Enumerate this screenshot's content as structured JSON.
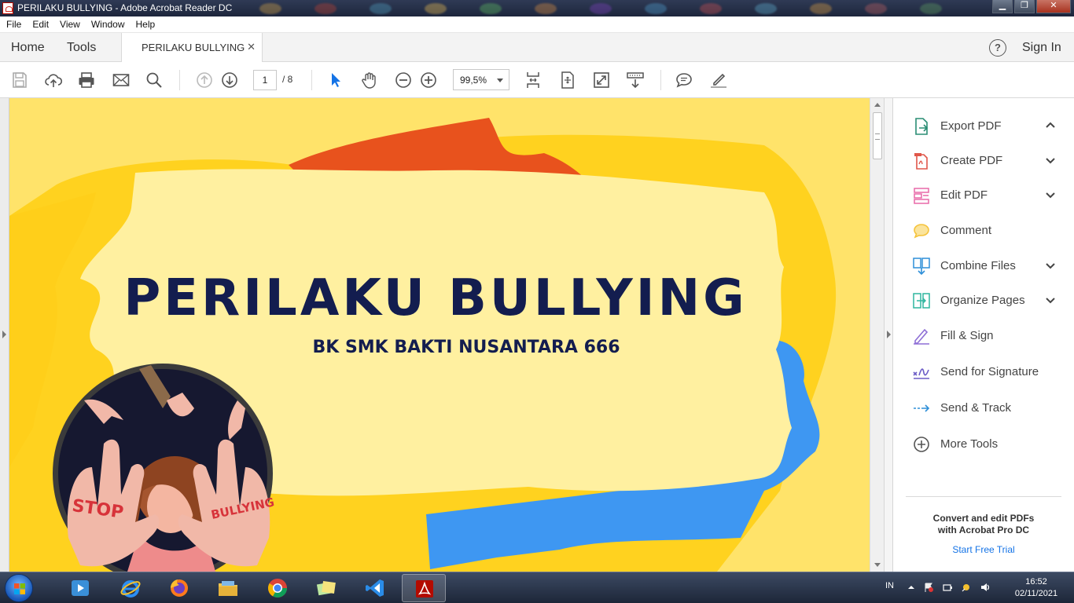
{
  "window": {
    "title": "PERILAKU BULLYING - Adobe Acrobat Reader DC"
  },
  "menu": [
    "File",
    "Edit",
    "View",
    "Window",
    "Help"
  ],
  "tabs": {
    "home": "Home",
    "tools": "Tools",
    "document": "PERILAKU BULLYING",
    "signin": "Sign In"
  },
  "toolbar": {
    "page_current": "1",
    "page_total": "/ 8",
    "zoom": "99,5%",
    "icons": [
      "save-icon",
      "cloud-upload-icon",
      "print-icon",
      "email-icon",
      "search-icon",
      "page-up-icon",
      "page-down-icon",
      "select-arrow-icon",
      "hand-icon",
      "zoom-out-icon",
      "zoom-in-icon",
      "fit-page-icon",
      "full-screen-icon",
      "expand-icon",
      "read-mode-icon",
      "comment-icon",
      "highlight-pen-icon"
    ]
  },
  "document": {
    "title": "PERILAKU BULLYING",
    "subtitle": "BK SMK BAKTI NUSANTARA 666",
    "sticker_text": [
      "STOP",
      "BULLYING"
    ]
  },
  "right_panel": {
    "items": [
      {
        "label": "Export PDF",
        "icon": "export-pdf-icon",
        "chevron": "up",
        "color": "#2a8d74"
      },
      {
        "label": "Create PDF",
        "icon": "create-pdf-icon",
        "chevron": "down",
        "color": "#e0574a"
      },
      {
        "label": "Edit PDF",
        "icon": "edit-pdf-icon",
        "chevron": "down",
        "color": "#e868a8"
      },
      {
        "label": "Comment",
        "icon": "comment-icon",
        "chevron": "",
        "color": "#f5c33b"
      },
      {
        "label": "Combine Files",
        "icon": "combine-files-icon",
        "chevron": "down",
        "color": "#2f8fd8"
      },
      {
        "label": "Organize Pages",
        "icon": "organize-pages-icon",
        "chevron": "down",
        "color": "#2fb59f"
      },
      {
        "label": "Fill & Sign",
        "icon": "fill-sign-icon",
        "chevron": "",
        "color": "#8e6fd6"
      },
      {
        "label": "Send for Signature",
        "icon": "send-signature-icon",
        "chevron": "",
        "color": "#6b5cc6"
      },
      {
        "label": "Send & Track",
        "icon": "send-track-icon",
        "chevron": "",
        "color": "#2f8fd8"
      },
      {
        "label": "More Tools",
        "icon": "more-tools-icon",
        "chevron": "",
        "color": "#555555"
      }
    ],
    "promo_line1": "Convert and edit PDFs",
    "promo_line2": "with Acrobat Pro DC",
    "trial_link": "Start Free Trial"
  },
  "taskbar": {
    "apps": [
      "windows-media-player-icon",
      "internet-explorer-icon",
      "firefox-icon",
      "file-explorer-icon",
      "chrome-icon",
      "sticky-notes-icon",
      "vscode-icon",
      "acrobat-reader-icon"
    ],
    "language": "IN",
    "time": "16:52",
    "date": "02/11/2021"
  }
}
